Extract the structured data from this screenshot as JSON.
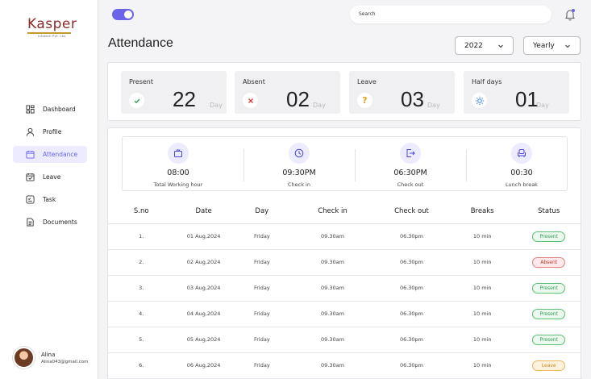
{
  "logo": {
    "main": "Kasper",
    "sub": "Infotech Pvt. Ltd."
  },
  "sidebar": {
    "items": [
      {
        "label": "Dashboard",
        "icon": "dashboard-icon",
        "active": false
      },
      {
        "label": "Profile",
        "icon": "profile-icon",
        "active": false
      },
      {
        "label": "Attendance",
        "icon": "calendar-icon",
        "active": true
      },
      {
        "label": "Leave",
        "icon": "calendar-check-icon",
        "active": false
      },
      {
        "label": "Task",
        "icon": "task-icon",
        "active": false
      },
      {
        "label": "Documents",
        "icon": "document-icon",
        "active": false
      }
    ]
  },
  "user": {
    "name": "Alina",
    "email": "Alina043@gmail.com"
  },
  "header": {
    "search_placeholder": "Search"
  },
  "page": {
    "title": "Attendance",
    "year": "2022",
    "period": "Yearly"
  },
  "summary": [
    {
      "label": "Present",
      "value": "22",
      "unit": "Day",
      "icon": "check-icon",
      "color": "#2e9a4c"
    },
    {
      "label": "Absent",
      "value": "02",
      "unit": "Day",
      "icon": "cross-icon",
      "color": "#d63a3a"
    },
    {
      "label": "Leave",
      "value": "03",
      "unit": "Day",
      "icon": "question-icon",
      "color": "#e3a21a"
    },
    {
      "label": "Half days",
      "value": "01",
      "unit": "Day",
      "icon": "sun-icon",
      "color": "#3d8ad8"
    }
  ],
  "timing": [
    {
      "value": "08:00",
      "label": "Total Working hour",
      "icon": "briefcase-icon"
    },
    {
      "value": "09:30PM",
      "label": "Check in",
      "icon": "clock-icon"
    },
    {
      "value": "06:30PM",
      "label": "Check out",
      "icon": "exit-icon"
    },
    {
      "value": "00:30",
      "label": "Lunch break",
      "icon": "chair-icon"
    }
  ],
  "table": {
    "headers": [
      "S.no",
      "Date",
      "Day",
      "Check in",
      "Check out",
      "Breaks",
      "Status"
    ],
    "rows": [
      [
        "1.",
        "01 Aug,2024",
        "Friday",
        "09.30am",
        "06.30pm",
        "10 min",
        "Present"
      ],
      [
        "2.",
        "02 Aug,2024",
        "Friday",
        "09.30am",
        "06.30pm",
        "10 min",
        "Absent"
      ],
      [
        "3.",
        "03 Aug,2024",
        "Friday",
        "09.30am",
        "06.30pm",
        "10 min",
        "Present"
      ],
      [
        "4.",
        "04 Aug,2024",
        "Friday",
        "09.30am",
        "06.30pm",
        "10 min",
        "Present"
      ],
      [
        "5.",
        "05 Aug,2024",
        "Friday",
        "09.30am",
        "06.30pm",
        "10 min",
        "Present"
      ],
      [
        "6.",
        "06 Aug,2024",
        "Friday",
        "09.30am",
        "06.30pm",
        "10 min",
        "Leave"
      ]
    ]
  },
  "colors": {
    "accent": "#6b64e8",
    "present": "#3a9a55",
    "absent": "#c0392b",
    "leave": "#c58a1f"
  }
}
